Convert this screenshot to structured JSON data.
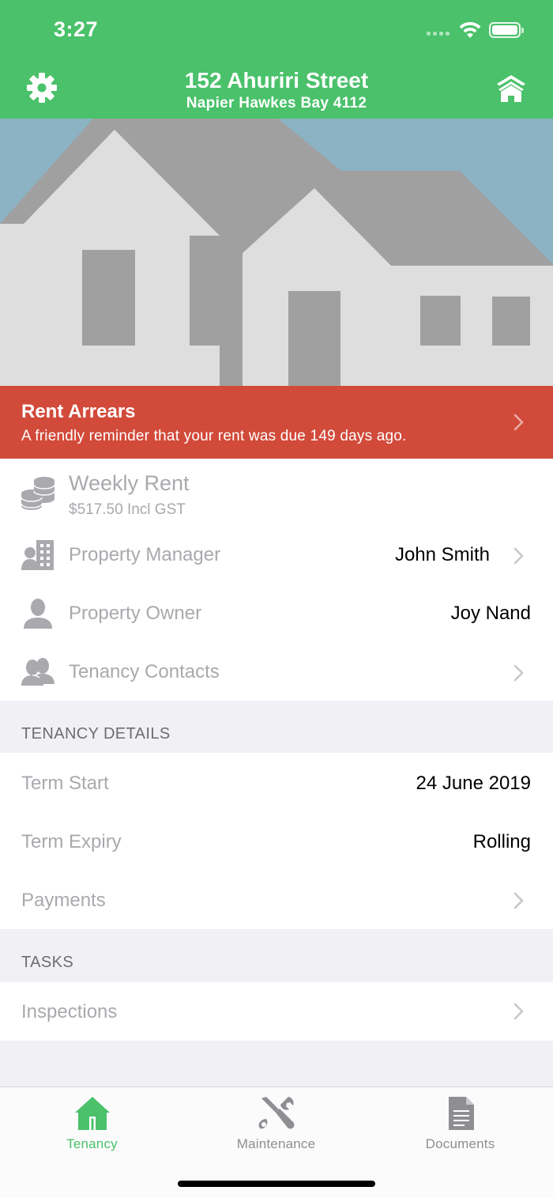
{
  "status_bar": {
    "time": "3:27"
  },
  "header": {
    "title": "152 Ahuriri Street",
    "subtitle": "Napier Hawkes Bay 4112",
    "settings_icon": "gear-icon",
    "property_icon": "houses-icon"
  },
  "colors": {
    "brand_green": "#4ac16a",
    "alert_red": "#d24a3a",
    "muted_label": "#a9a9ae",
    "section_bg": "#f0f0f5"
  },
  "alert": {
    "title": "Rent Arrears",
    "message": "A friendly reminder that your rent was due 149 days ago."
  },
  "summary": {
    "weekly_rent_label": "Weekly Rent",
    "weekly_rent_value": "$517.50 Incl GST",
    "manager_label": "Property Manager",
    "manager_value": "John Smith",
    "owner_label": "Property Owner",
    "owner_value": "Joy Nand",
    "contacts_label": "Tenancy Contacts"
  },
  "tenancy_details": {
    "section_title": "TENANCY DETAILS",
    "term_start_label": "Term Start",
    "term_start_value": "24 June 2019",
    "term_expiry_label": "Term Expiry",
    "term_expiry_value": "Rolling",
    "payments_label": "Payments"
  },
  "tasks": {
    "section_title": "TASKS",
    "inspections_label": "Inspections"
  },
  "tabbar": {
    "tabs": [
      {
        "label": "Tenancy",
        "icon": "house-icon",
        "active": true
      },
      {
        "label": "Maintenance",
        "icon": "tools-icon",
        "active": false
      },
      {
        "label": "Documents",
        "icon": "document-icon",
        "active": false
      }
    ]
  }
}
